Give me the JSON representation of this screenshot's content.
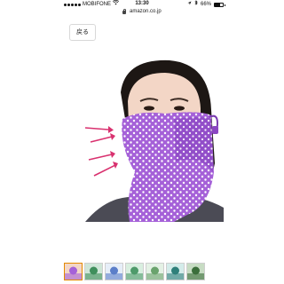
{
  "status_bar": {
    "carrier": "MOBIFONE",
    "wifi_icon": "wifi-icon",
    "time": "13:30",
    "location_icon": "location-arrow-icon",
    "bluetooth_icon": "bluetooth-icon",
    "battery_percent": "66%",
    "battery_level": 0.66,
    "signal_bars": 5
  },
  "browser": {
    "lock_icon": "lock-icon",
    "url": "amazon.co.jp"
  },
  "page": {
    "back_label": "戻る"
  },
  "product": {
    "image_subject": "woman wearing purple polka dot face mask",
    "accent_color": "#9b5bd3"
  },
  "thumbnails": {
    "count": 7,
    "selected_index": 0,
    "selected_border_color": "#e48a00"
  }
}
